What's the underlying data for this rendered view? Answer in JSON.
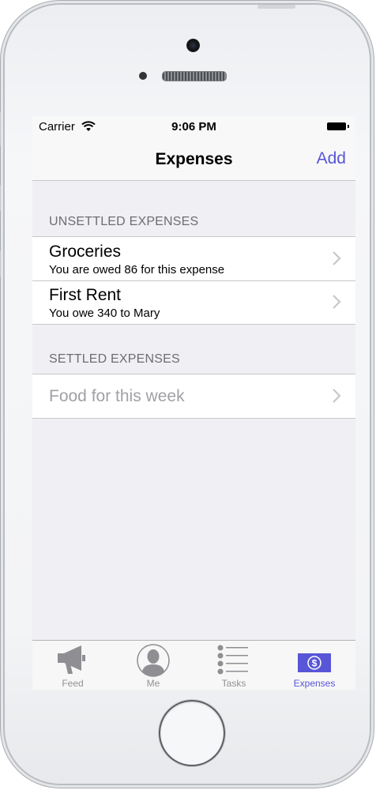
{
  "status_bar": {
    "carrier": "Carrier",
    "time": "9:06 PM"
  },
  "nav": {
    "title": "Expenses",
    "add_label": "Add",
    "accent_color": "#5856d6"
  },
  "unsettled": {
    "header": "UNSETTLED EXPENSES",
    "items": [
      {
        "title": "Groceries",
        "subtitle": "You are owed 86 for this expense"
      },
      {
        "title": "First Rent",
        "subtitle": "You owe 340 to Mary"
      }
    ]
  },
  "settled": {
    "header": "SETTLED EXPENSES",
    "items": [
      {
        "title": "Food for this week"
      }
    ]
  },
  "tabs": [
    {
      "label": "Feed",
      "icon": "megaphone-icon",
      "active": false
    },
    {
      "label": "Me",
      "icon": "person-icon",
      "active": false
    },
    {
      "label": "Tasks",
      "icon": "list-icon",
      "active": false
    },
    {
      "label": "Expenses",
      "icon": "dollar-icon",
      "active": true
    }
  ]
}
